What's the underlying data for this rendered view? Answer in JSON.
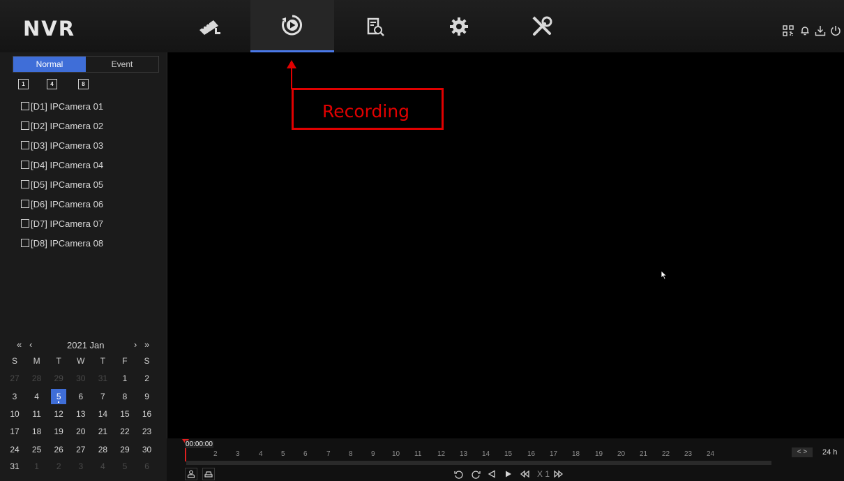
{
  "app": {
    "logo": "NVR"
  },
  "nav": {
    "tabs": [
      {
        "name": "live-view",
        "icon": "camera-icon"
      },
      {
        "name": "playback",
        "icon": "playback-icon",
        "active": true
      },
      {
        "name": "file-search",
        "icon": "file-search-icon"
      },
      {
        "name": "configuration",
        "icon": "gear-icon"
      },
      {
        "name": "maintenance",
        "icon": "tools-icon"
      }
    ],
    "right_icons": [
      "qr-code-icon",
      "bell-icon",
      "download-icon",
      "power-icon"
    ]
  },
  "sidebar": {
    "mode_tabs": {
      "normal": "Normal",
      "event": "Event"
    },
    "split_buttons": [
      "1",
      "4",
      "8"
    ],
    "cameras": [
      "[D1] IPCamera 01",
      "[D2] IPCamera 02",
      "[D3] IPCamera 03",
      "[D4] IPCamera 04",
      "[D5] IPCamera 05",
      "[D6] IPCamera 06",
      "[D7] IPCamera 07",
      "[D8] IPCamera 08"
    ]
  },
  "calendar": {
    "month_label": "2021 Jan",
    "prev_year": "«",
    "prev_month": "‹",
    "next_month": "›",
    "next_year": "»",
    "weekdays": [
      "S",
      "M",
      "T",
      "W",
      "T",
      "F",
      "S"
    ],
    "weeks": [
      [
        "27",
        "28",
        "29",
        "30",
        "31",
        "1",
        "2"
      ],
      [
        "3",
        "4",
        "5",
        "6",
        "7",
        "8",
        "9"
      ],
      [
        "10",
        "11",
        "12",
        "13",
        "14",
        "15",
        "16"
      ],
      [
        "17",
        "18",
        "19",
        "20",
        "21",
        "22",
        "23"
      ],
      [
        "24",
        "25",
        "26",
        "27",
        "28",
        "29",
        "30"
      ],
      [
        "31",
        "1",
        "2",
        "3",
        "4",
        "5",
        "6"
      ]
    ],
    "selected_day": "5"
  },
  "annotation": {
    "label": "Recording"
  },
  "timeline": {
    "current_time": "00:00:00",
    "hours": [
      "2",
      "3",
      "4",
      "5",
      "6",
      "7",
      "8",
      "9",
      "10",
      "11",
      "12",
      "13",
      "14",
      "15",
      "16",
      "17",
      "18",
      "19",
      "20",
      "21",
      "22",
      "23",
      "24"
    ],
    "zoom_label": "24 h",
    "nav_label": "< >",
    "speed_label": "X 1"
  },
  "colors": {
    "accent": "#3f6ed8",
    "annotation": "#e00000",
    "marker": "#e02020"
  }
}
